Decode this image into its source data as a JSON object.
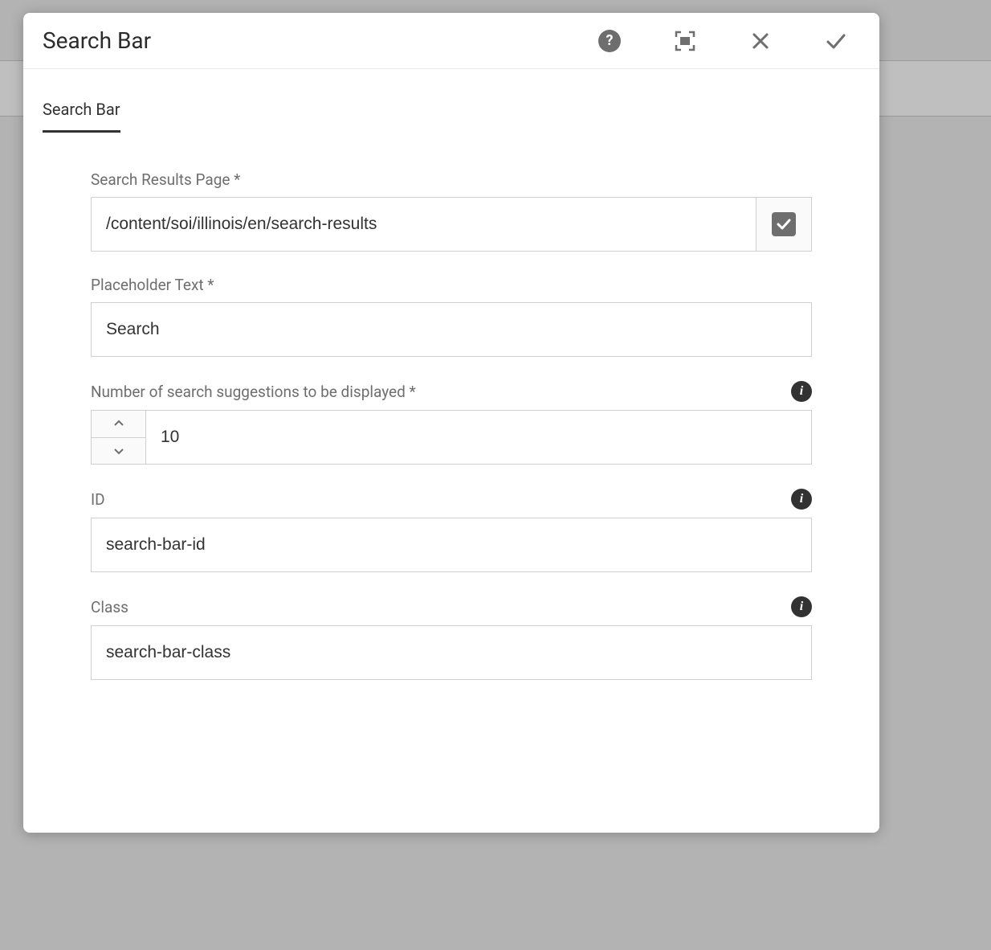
{
  "dialog": {
    "title": "Search Bar",
    "tabs": [
      {
        "label": "Search Bar"
      }
    ],
    "fields": {
      "searchResultsPage": {
        "label": "Search Results Page *",
        "value": "/content/soi/illinois/en/search-results"
      },
      "placeholderText": {
        "label": "Placeholder Text *",
        "value": "Search"
      },
      "numSuggestions": {
        "label": "Number of search suggestions to be displayed *",
        "value": "10"
      },
      "id": {
        "label": "ID",
        "value": "search-bar-id"
      },
      "class": {
        "label": "Class",
        "value": "search-bar-class"
      }
    }
  }
}
